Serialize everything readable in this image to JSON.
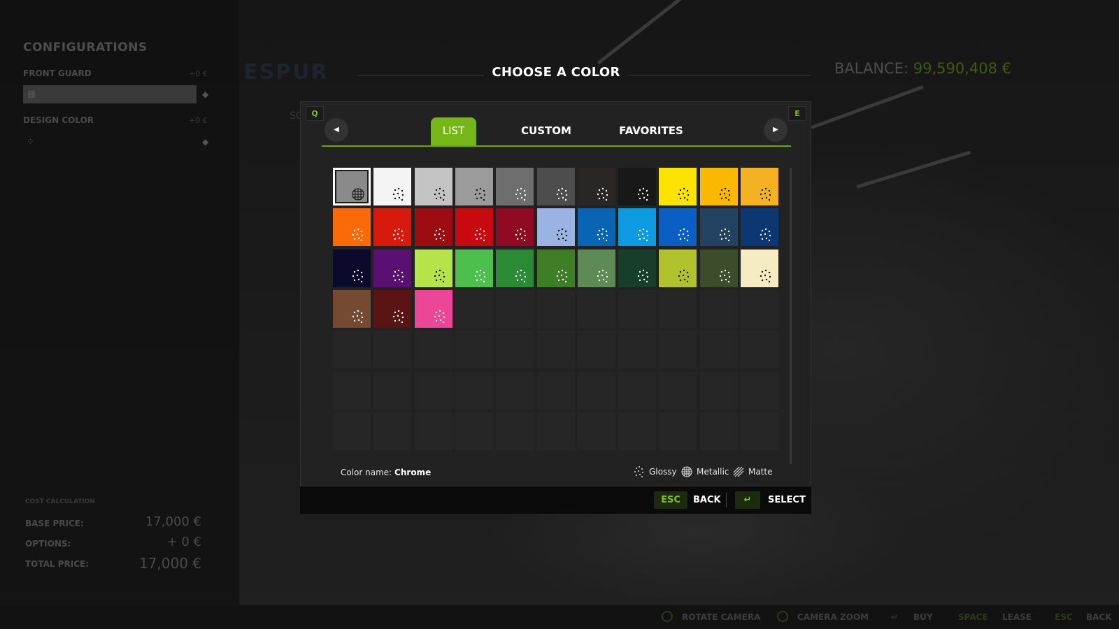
{
  "background": {
    "sidebar": {
      "title": "CONFIGURATIONS",
      "front_guard_label": "FRONT GUARD",
      "front_guard_price": "+0 €",
      "design_color_label": "DESIGN COLOR",
      "design_color_price": "+0 €",
      "cost_heading": "COST CALCULATION",
      "base_price_label": "BASE PRICE:",
      "base_price_value": "17,000 €",
      "options_label": "OPTIONS:",
      "options_value": "+ 0 €",
      "total_price_label": "TOTAL PRICE:",
      "total_price_value": "17,000 €"
    },
    "brand_ghost": "ESPUR",
    "sc_ghost": "SC",
    "balance_label": "BALANCE:",
    "balance_value": "99,590,408 €"
  },
  "dialog": {
    "title": "CHOOSE A COLOR",
    "key_prev": "Q",
    "key_next": "E",
    "tabs": [
      {
        "label": "LIST",
        "active": true
      },
      {
        "label": "CUSTOM",
        "active": false
      },
      {
        "label": "FAVORITES",
        "active": false
      }
    ],
    "colors": [
      {
        "hex": "#8a8a8a",
        "finish": "metallic",
        "selected": true
      },
      {
        "hex": "#f4f4f4",
        "finish": "glossy"
      },
      {
        "hex": "#c3c3c3",
        "finish": "glossy"
      },
      {
        "hex": "#9b9b9b",
        "finish": "glossy"
      },
      {
        "hex": "#6e6e6e",
        "finish": "glossy"
      },
      {
        "hex": "#4d4d4d",
        "finish": "glossy"
      },
      {
        "hex": "#2b2626",
        "finish": "glossy"
      },
      {
        "hex": "#181818",
        "finish": "glossy"
      },
      {
        "hex": "#fde400",
        "finish": "glossy"
      },
      {
        "hex": "#fbb800",
        "finish": "glossy"
      },
      {
        "hex": "#f4b223",
        "finish": "glossy"
      },
      {
        "hex": "#fb6a08",
        "finish": "glossy"
      },
      {
        "hex": "#d61a0c",
        "finish": "glossy"
      },
      {
        "hex": "#9c0c10",
        "finish": "glossy"
      },
      {
        "hex": "#c80a10",
        "finish": "glossy"
      },
      {
        "hex": "#8f0a22",
        "finish": "glossy"
      },
      {
        "hex": "#9ab3e3",
        "finish": "glossy"
      },
      {
        "hex": "#0a64b4",
        "finish": "glossy"
      },
      {
        "hex": "#0c9be0",
        "finish": "glossy"
      },
      {
        "hex": "#0a5fc4",
        "finish": "glossy"
      },
      {
        "hex": "#234160",
        "finish": "glossy"
      },
      {
        "hex": "#0d3772",
        "finish": "glossy"
      },
      {
        "hex": "#0c0a2c",
        "finish": "glossy"
      },
      {
        "hex": "#5a1073",
        "finish": "glossy"
      },
      {
        "hex": "#b4e34a",
        "finish": "glossy"
      },
      {
        "hex": "#4cbf4c",
        "finish": "glossy"
      },
      {
        "hex": "#2a8a36",
        "finish": "glossy"
      },
      {
        "hex": "#3e7e26",
        "finish": "glossy"
      },
      {
        "hex": "#5e8a55",
        "finish": "glossy"
      },
      {
        "hex": "#173e2a",
        "finish": "glossy"
      },
      {
        "hex": "#b0c32d",
        "finish": "glossy"
      },
      {
        "hex": "#3c4d2b",
        "finish": "glossy"
      },
      {
        "hex": "#f7ebc3",
        "finish": "glossy"
      },
      {
        "hex": "#754a33",
        "finish": "glossy"
      },
      {
        "hex": "#5a1414",
        "finish": "glossy"
      },
      {
        "hex": "#ec4699",
        "finish": "glossy"
      }
    ],
    "color_name_label": "Color name:",
    "color_name_value": "Chrome",
    "legend": {
      "glossy": "Glossy",
      "metallic": "Metallic",
      "matte": "Matte"
    },
    "accent_color": "#76b619"
  },
  "footer": {
    "back_key": "ESC",
    "back_label": "BACK",
    "select_label": "SELECT"
  },
  "bottom_bar": {
    "rotate": "ROTATE CAMERA",
    "zoom": "CAMERA ZOOM",
    "buy": "BUY",
    "lease_key": "SPACE",
    "lease": "LEASE",
    "back_key": "ESC",
    "back": "BACK"
  }
}
